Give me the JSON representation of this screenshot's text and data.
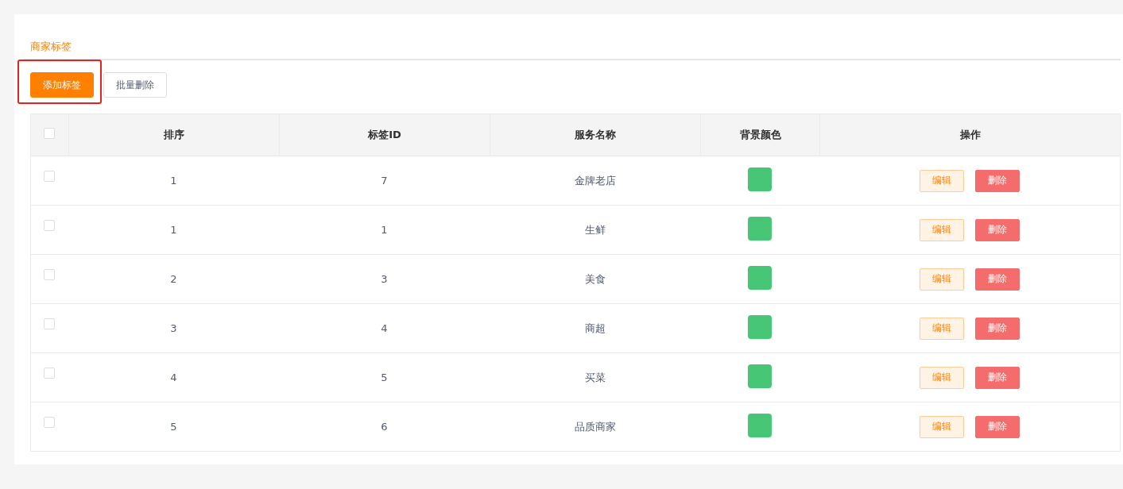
{
  "tab": {
    "label": "商家标签",
    "selected": true
  },
  "toolbar": {
    "buttons": [
      {
        "label": "添加标签",
        "kind": "primary",
        "highlighted": true
      },
      {
        "label": "批量删除",
        "kind": "plain",
        "highlighted": false
      }
    ]
  },
  "table": {
    "select_all": {
      "checked": false
    },
    "columns": [
      "排序",
      "标签ID",
      "服务名称",
      "背景颜色",
      "操作"
    ],
    "rows": [
      {
        "checked": false,
        "sort": "1",
        "tag_id": "7",
        "name": "金牌老店",
        "color": "#47c775",
        "actions": [
          "编辑",
          "删除"
        ]
      },
      {
        "checked": false,
        "sort": "1",
        "tag_id": "1",
        "name": "生鲜",
        "color": "#47c775",
        "actions": [
          "编辑",
          "删除"
        ]
      },
      {
        "checked": false,
        "sort": "2",
        "tag_id": "3",
        "name": "美食",
        "color": "#47c775",
        "actions": [
          "编辑",
          "删除"
        ]
      },
      {
        "checked": false,
        "sort": "3",
        "tag_id": "4",
        "name": "商超",
        "color": "#47c775",
        "actions": [
          "编辑",
          "删除"
        ]
      },
      {
        "checked": false,
        "sort": "4",
        "tag_id": "5",
        "name": "买菜",
        "color": "#47c775",
        "actions": [
          "编辑",
          "删除"
        ]
      },
      {
        "checked": false,
        "sort": "5",
        "tag_id": "6",
        "name": "品质商家",
        "color": "#47c775",
        "actions": [
          "编辑",
          "删除"
        ]
      }
    ]
  }
}
